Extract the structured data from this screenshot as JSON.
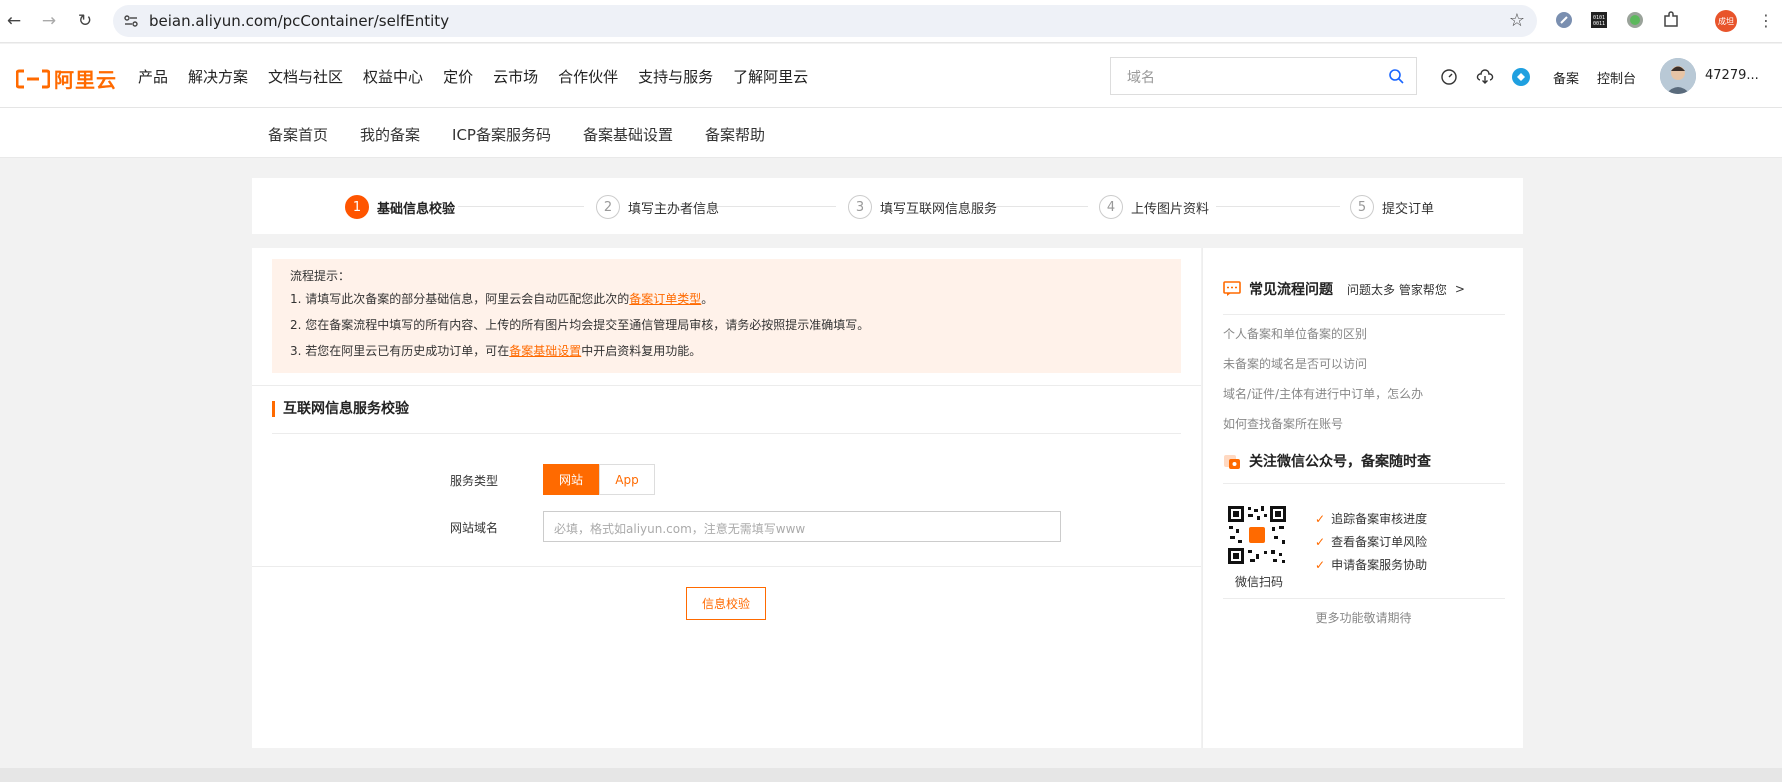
{
  "browser": {
    "url": "beian.aliyun.com/pcContainer/selfEntity",
    "profile_label": "成坦"
  },
  "header": {
    "logo_text": "阿里云",
    "nav": [
      "产品",
      "解决方案",
      "文档与社区",
      "权益中心",
      "定价",
      "云市场",
      "合作伙伴",
      "支持与服务",
      "了解阿里云"
    ],
    "search_placeholder": "域名",
    "beian_link": "备案",
    "console_link": "控制台",
    "user_name": "47279..."
  },
  "subnav": [
    "备案首页",
    "我的备案",
    "ICP备案服务码",
    "备案基础设置",
    "备案帮助"
  ],
  "steps": [
    {
      "num": "1",
      "label": "基础信息校验"
    },
    {
      "num": "2",
      "label": "填写主办者信息"
    },
    {
      "num": "3",
      "label": "填写互联网信息服务"
    },
    {
      "num": "4",
      "label": "上传图片资料"
    },
    {
      "num": "5",
      "label": "提交订单"
    }
  ],
  "tips": {
    "title": "流程提示：",
    "line1_pre": "1. 请填写此次备案的部分基础信息，阿里云会自动匹配您此次的",
    "line1_link": "备案订单类型",
    "line1_post": "。",
    "line2": "2. 您在备案流程中填写的所有内容、上传的所有图片均会提交至通信管理局审核，请务必按照提示准确填写。",
    "line3_pre": "3. 若您在阿里云已有历史成功订单，可在",
    "line3_link": "备案基础设置",
    "line3_post": "中开启资料复用功能。"
  },
  "form": {
    "section_title": "互联网信息服务校验",
    "service_type_label": "服务类型",
    "service_options": [
      "网站",
      "App"
    ],
    "domain_label": "网站域名",
    "domain_placeholder": "必填，格式如aliyun.com，注意无需填写www",
    "verify_button": "信息校验"
  },
  "side": {
    "faq_title": "常见流程问题",
    "faq_sub": "问题太多 管家帮您",
    "faqs": [
      "个人备案和单位备案的区别",
      "未备案的域名是否可以访问",
      "域名/证件/主体有进行中订单，怎么办",
      "如何查找备案所在账号"
    ],
    "wechat_title": "关注微信公众号，备案随时查",
    "qr_label": "微信扫码",
    "features": [
      "追踪备案审核进度",
      "查看备案订单风险",
      "申请备案服务协助"
    ],
    "more": "更多功能敬请期待"
  },
  "colors": {
    "accent": "#ff6a00",
    "tips_bg": "#fff2ea"
  }
}
